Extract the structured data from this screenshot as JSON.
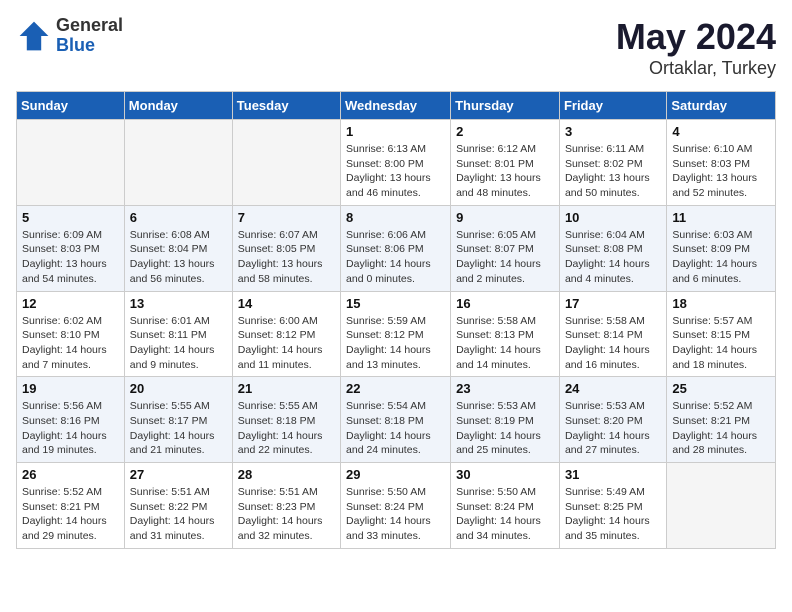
{
  "header": {
    "logo_general": "General",
    "logo_blue": "Blue",
    "title": "May 2024",
    "location": "Ortaklar, Turkey"
  },
  "weekdays": [
    "Sunday",
    "Monday",
    "Tuesday",
    "Wednesday",
    "Thursday",
    "Friday",
    "Saturday"
  ],
  "weeks": [
    [
      {
        "day": "",
        "info": ""
      },
      {
        "day": "",
        "info": ""
      },
      {
        "day": "",
        "info": ""
      },
      {
        "day": "1",
        "info": "Sunrise: 6:13 AM\nSunset: 8:00 PM\nDaylight: 13 hours\nand 46 minutes."
      },
      {
        "day": "2",
        "info": "Sunrise: 6:12 AM\nSunset: 8:01 PM\nDaylight: 13 hours\nand 48 minutes."
      },
      {
        "day": "3",
        "info": "Sunrise: 6:11 AM\nSunset: 8:02 PM\nDaylight: 13 hours\nand 50 minutes."
      },
      {
        "day": "4",
        "info": "Sunrise: 6:10 AM\nSunset: 8:03 PM\nDaylight: 13 hours\nand 52 minutes."
      }
    ],
    [
      {
        "day": "5",
        "info": "Sunrise: 6:09 AM\nSunset: 8:03 PM\nDaylight: 13 hours\nand 54 minutes."
      },
      {
        "day": "6",
        "info": "Sunrise: 6:08 AM\nSunset: 8:04 PM\nDaylight: 13 hours\nand 56 minutes."
      },
      {
        "day": "7",
        "info": "Sunrise: 6:07 AM\nSunset: 8:05 PM\nDaylight: 13 hours\nand 58 minutes."
      },
      {
        "day": "8",
        "info": "Sunrise: 6:06 AM\nSunset: 8:06 PM\nDaylight: 14 hours\nand 0 minutes."
      },
      {
        "day": "9",
        "info": "Sunrise: 6:05 AM\nSunset: 8:07 PM\nDaylight: 14 hours\nand 2 minutes."
      },
      {
        "day": "10",
        "info": "Sunrise: 6:04 AM\nSunset: 8:08 PM\nDaylight: 14 hours\nand 4 minutes."
      },
      {
        "day": "11",
        "info": "Sunrise: 6:03 AM\nSunset: 8:09 PM\nDaylight: 14 hours\nand 6 minutes."
      }
    ],
    [
      {
        "day": "12",
        "info": "Sunrise: 6:02 AM\nSunset: 8:10 PM\nDaylight: 14 hours\nand 7 minutes."
      },
      {
        "day": "13",
        "info": "Sunrise: 6:01 AM\nSunset: 8:11 PM\nDaylight: 14 hours\nand 9 minutes."
      },
      {
        "day": "14",
        "info": "Sunrise: 6:00 AM\nSunset: 8:12 PM\nDaylight: 14 hours\nand 11 minutes."
      },
      {
        "day": "15",
        "info": "Sunrise: 5:59 AM\nSunset: 8:12 PM\nDaylight: 14 hours\nand 13 minutes."
      },
      {
        "day": "16",
        "info": "Sunrise: 5:58 AM\nSunset: 8:13 PM\nDaylight: 14 hours\nand 14 minutes."
      },
      {
        "day": "17",
        "info": "Sunrise: 5:58 AM\nSunset: 8:14 PM\nDaylight: 14 hours\nand 16 minutes."
      },
      {
        "day": "18",
        "info": "Sunrise: 5:57 AM\nSunset: 8:15 PM\nDaylight: 14 hours\nand 18 minutes."
      }
    ],
    [
      {
        "day": "19",
        "info": "Sunrise: 5:56 AM\nSunset: 8:16 PM\nDaylight: 14 hours\nand 19 minutes."
      },
      {
        "day": "20",
        "info": "Sunrise: 5:55 AM\nSunset: 8:17 PM\nDaylight: 14 hours\nand 21 minutes."
      },
      {
        "day": "21",
        "info": "Sunrise: 5:55 AM\nSunset: 8:18 PM\nDaylight: 14 hours\nand 22 minutes."
      },
      {
        "day": "22",
        "info": "Sunrise: 5:54 AM\nSunset: 8:18 PM\nDaylight: 14 hours\nand 24 minutes."
      },
      {
        "day": "23",
        "info": "Sunrise: 5:53 AM\nSunset: 8:19 PM\nDaylight: 14 hours\nand 25 minutes."
      },
      {
        "day": "24",
        "info": "Sunrise: 5:53 AM\nSunset: 8:20 PM\nDaylight: 14 hours\nand 27 minutes."
      },
      {
        "day": "25",
        "info": "Sunrise: 5:52 AM\nSunset: 8:21 PM\nDaylight: 14 hours\nand 28 minutes."
      }
    ],
    [
      {
        "day": "26",
        "info": "Sunrise: 5:52 AM\nSunset: 8:21 PM\nDaylight: 14 hours\nand 29 minutes."
      },
      {
        "day": "27",
        "info": "Sunrise: 5:51 AM\nSunset: 8:22 PM\nDaylight: 14 hours\nand 31 minutes."
      },
      {
        "day": "28",
        "info": "Sunrise: 5:51 AM\nSunset: 8:23 PM\nDaylight: 14 hours\nand 32 minutes."
      },
      {
        "day": "29",
        "info": "Sunrise: 5:50 AM\nSunset: 8:24 PM\nDaylight: 14 hours\nand 33 minutes."
      },
      {
        "day": "30",
        "info": "Sunrise: 5:50 AM\nSunset: 8:24 PM\nDaylight: 14 hours\nand 34 minutes."
      },
      {
        "day": "31",
        "info": "Sunrise: 5:49 AM\nSunset: 8:25 PM\nDaylight: 14 hours\nand 35 minutes."
      },
      {
        "day": "",
        "info": ""
      }
    ]
  ]
}
